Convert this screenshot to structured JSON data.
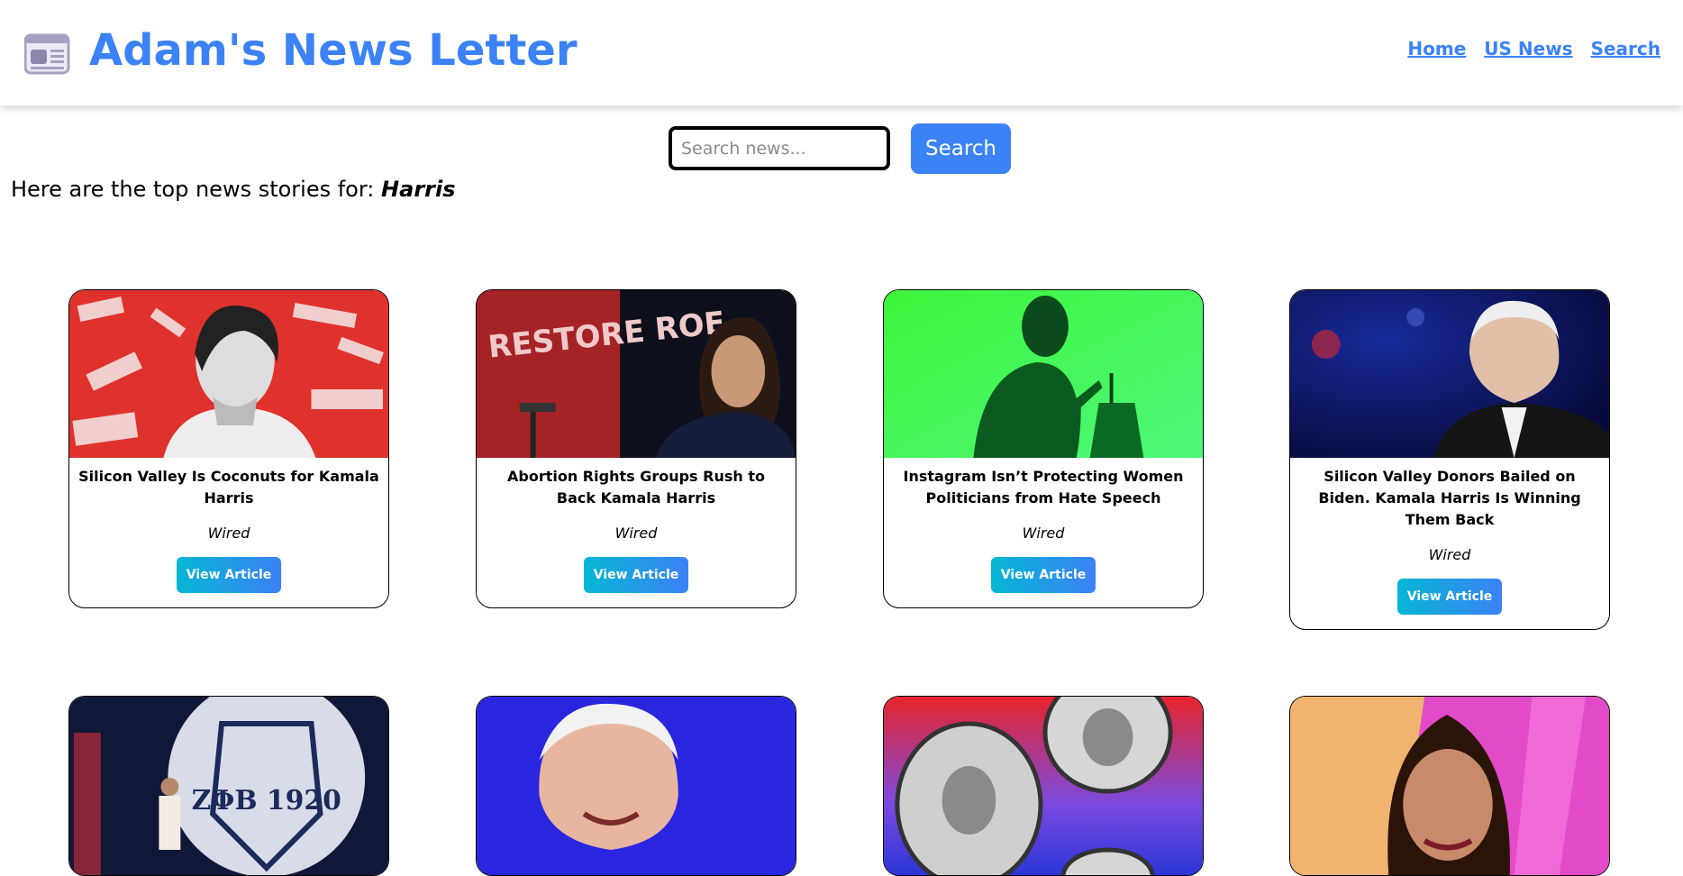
{
  "header": {
    "title": "Adam's News Letter",
    "logo_icon": "newspaper-icon",
    "nav": [
      {
        "label": "Home"
      },
      {
        "label": "US News"
      },
      {
        "label": "Search"
      }
    ]
  },
  "search": {
    "placeholder": "Search news...",
    "value": "",
    "button_label": "Search"
  },
  "results": {
    "prefix": "Here are the top news stories for:",
    "query": "Harris"
  },
  "articles": [
    {
      "title": "Silicon Valley Is Coconuts for Kamala Harris",
      "source": "Wired",
      "button_label": "View Article"
    },
    {
      "title": "Abortion Rights Groups Rush to Back Kamala Harris",
      "source": "Wired",
      "button_label": "View Article",
      "image_text": "RESTORE ROE"
    },
    {
      "title": "Instagram Isn’t Protecting Women Politicians from Hate Speech",
      "source": "Wired",
      "button_label": "View Article"
    },
    {
      "title": "Silicon Valley Donors Bailed on Biden. Kamala Harris Is Winning Them Back",
      "source": "Wired",
      "button_label": "View Article"
    },
    {
      "title": "",
      "source": "",
      "button_label": "",
      "image_text": "ΖΦΒ 1920"
    },
    {
      "title": "",
      "source": "",
      "button_label": ""
    },
    {
      "title": "",
      "source": "",
      "button_label": ""
    },
    {
      "title": "",
      "source": "",
      "button_label": ""
    }
  ],
  "colors": {
    "brand": "#3b82f6",
    "button_gradient_start": "#06b6d4",
    "button_gradient_end": "#3b82f6"
  }
}
